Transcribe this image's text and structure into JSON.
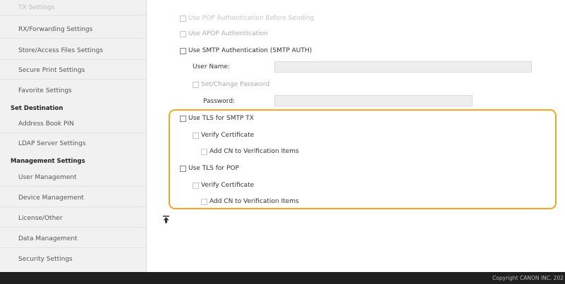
{
  "sidebar": {
    "items_top": [
      {
        "label": "TX Settings"
      },
      {
        "label": "RX/Forwarding Settings"
      },
      {
        "label": "Store/Access Files Settings"
      },
      {
        "label": "Secure Print Settings"
      },
      {
        "label": "Favorite Settings"
      }
    ],
    "section_destination": "Set Destination",
    "items_destination": [
      {
        "label": "Address Book PIN"
      },
      {
        "label": "LDAP Server Settings"
      }
    ],
    "section_management": "Management Settings",
    "items_management": [
      {
        "label": "User Management"
      },
      {
        "label": "Device Management"
      },
      {
        "label": "License/Other"
      },
      {
        "label": "Data Management"
      },
      {
        "label": "Security Settings"
      }
    ]
  },
  "form": {
    "pop_auth_before_sending": "Use POP Authentication Before Sending",
    "apop_auth": "Use APOP Authentication",
    "smtp_auth": "Use SMTP Authentication (SMTP AUTH)",
    "user_name_label": "User Name:",
    "user_name_value": "",
    "set_change_password": "Set/Change Password",
    "password_label": "Password:",
    "password_value": "",
    "tls_smtp_tx": "Use TLS for SMTP TX",
    "smtp_verify_cert": "Verify Certificate",
    "smtp_add_cn": "Add CN to Verification Items",
    "tls_pop": "Use TLS for POP",
    "pop_verify_cert": "Verify Certificate",
    "pop_add_cn": "Add CN to Verification Items"
  },
  "page_top_icon": "to-top-icon",
  "footer": {
    "copyright": "Copyright CANON INC. 202"
  },
  "colors": {
    "highlight": "#f5a623",
    "footer_bg": "#1f1f1f",
    "sidebar_bg": "#f1f1f1"
  }
}
